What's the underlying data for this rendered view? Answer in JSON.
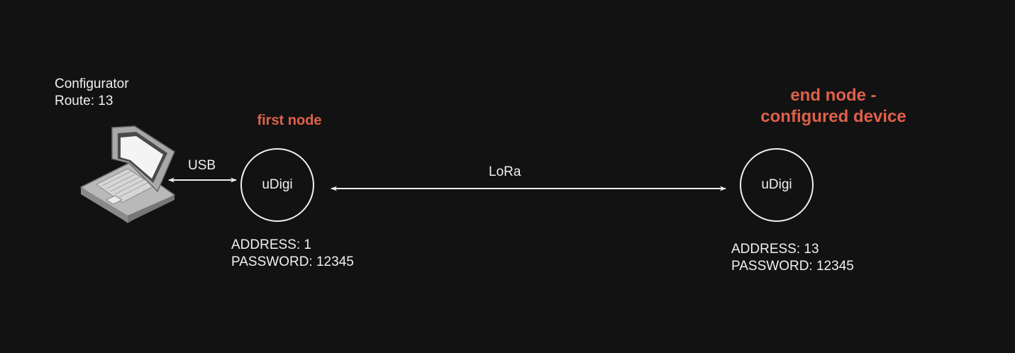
{
  "configurator": {
    "title": "Configurator",
    "route": "Route: 13"
  },
  "links": {
    "usb": "USB",
    "lora": "LoRa"
  },
  "first_node": {
    "heading": "first node",
    "name": "uDigi",
    "address": "ADDRESS: 1",
    "password": "PASSWORD: 12345"
  },
  "end_node": {
    "heading_line1": "end node -",
    "heading_line2": "configured device",
    "name": "uDigi",
    "address": "ADDRESS: 13",
    "password": "PASSWORD: 12345"
  },
  "icons": {
    "laptop": "laptop-icon"
  },
  "colors": {
    "background": "#121212",
    "foreground": "#f0f0f0",
    "accent": "#e0604a"
  }
}
